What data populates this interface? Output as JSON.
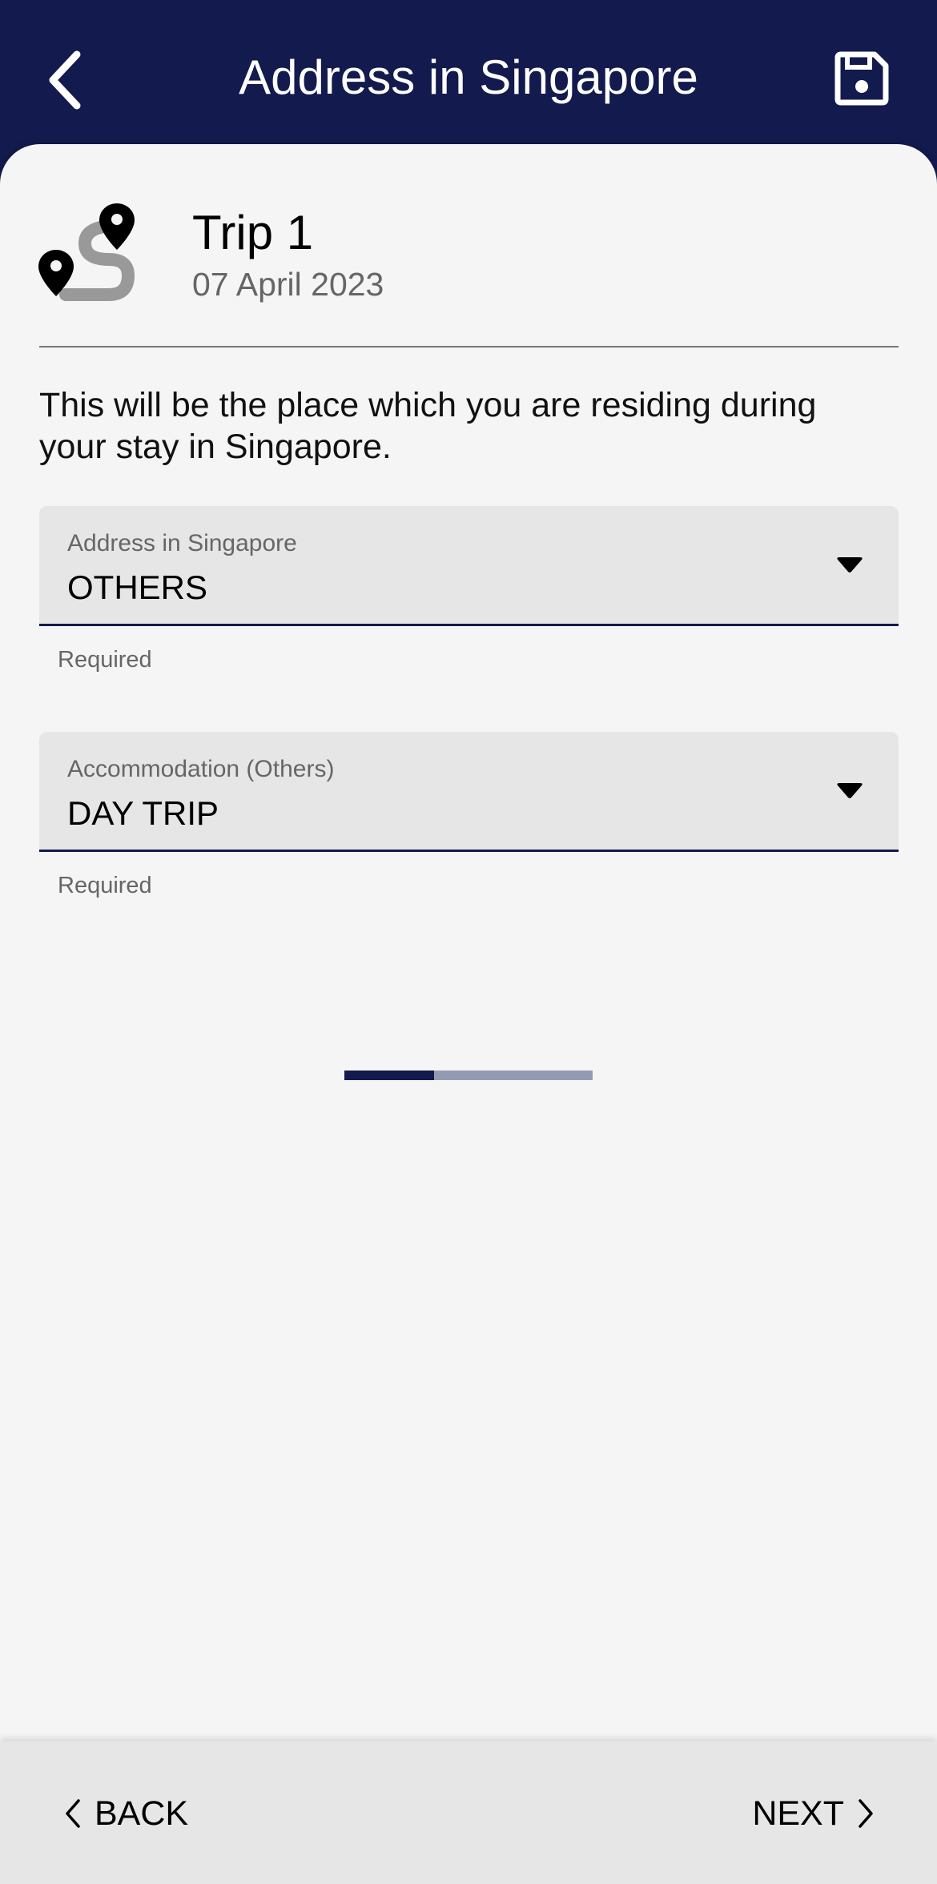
{
  "header": {
    "title": "Address in Singapore",
    "back_icon": "chevron-left-icon",
    "save_icon": "floppy-disk-icon"
  },
  "trip": {
    "title": "Trip 1",
    "date": "07 April 2023",
    "icon": "route-pins-icon"
  },
  "description": "This will be the place which you are residing during your stay in Singapore.",
  "fields": {
    "address": {
      "label": "Address in Singapore",
      "value": "OTHERS",
      "helper": "Required"
    },
    "accommodation": {
      "label": "Accommodation (Others)",
      "value": "DAY TRIP",
      "helper": "Required"
    }
  },
  "footer": {
    "back_label": "BACK",
    "next_label": "NEXT",
    "progress_fraction": 0.36
  },
  "colors": {
    "primary": "#131a4d",
    "background": "#f5f5f5",
    "field_bg": "#e6e6e6",
    "progress_track": "#959ab3"
  }
}
